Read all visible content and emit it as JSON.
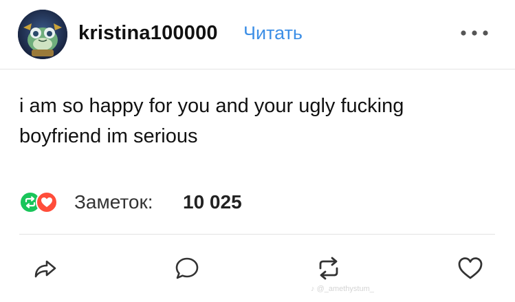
{
  "post": {
    "author": {
      "username": "kristina100000",
      "follow_label": "Читать",
      "avatar_icon": "frog-avatar-icon"
    },
    "more_icon": "ellipsis-icon",
    "body_text": "i am so happy for you and your ugly fucking\nboyfriend im serious",
    "notes": {
      "label": "Заметок:",
      "count": "10 025",
      "reblog_color": "#19c55a",
      "like_color": "#ff4d3a"
    },
    "actions": [
      {
        "name": "share",
        "icon": "share-arrow-icon"
      },
      {
        "name": "reply",
        "icon": "speech-bubble-icon"
      },
      {
        "name": "reblog",
        "icon": "reblog-icon"
      },
      {
        "name": "like",
        "icon": "heart-icon"
      }
    ],
    "accent_color": "#3d8fe6"
  },
  "watermark": "@_amethystum_"
}
